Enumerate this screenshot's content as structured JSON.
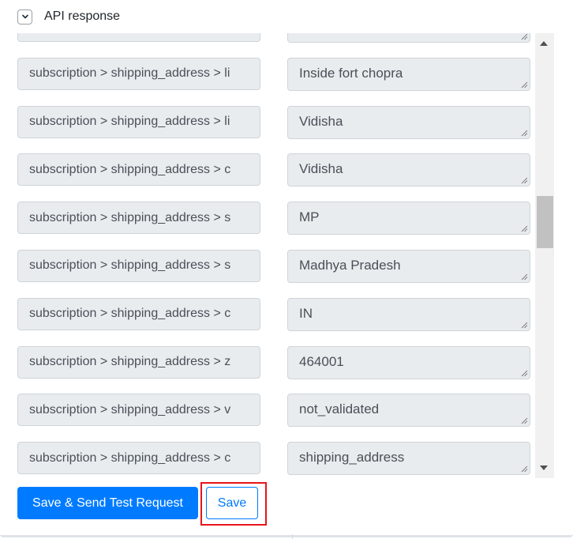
{
  "header": {
    "title": "API response",
    "toggle_icon": "chevron-down-icon"
  },
  "rows": [
    {
      "key": "",
      "value": ""
    },
    {
      "key": "subscription > shipping_address > li",
      "value": "Inside fort chopra"
    },
    {
      "key": "subscription > shipping_address > li",
      "value": "Vidisha"
    },
    {
      "key": "subscription > shipping_address > c",
      "value": "Vidisha"
    },
    {
      "key": "subscription > shipping_address > s",
      "value": "MP"
    },
    {
      "key": "subscription > shipping_address > s",
      "value": "Madhya Pradesh"
    },
    {
      "key": "subscription > shipping_address > c",
      "value": "IN"
    },
    {
      "key": "subscription > shipping_address > z",
      "value": "464001"
    },
    {
      "key": "subscription > shipping_address > v",
      "value": "not_validated"
    },
    {
      "key": "subscription > shipping_address > c",
      "value": "shipping_address"
    }
  ],
  "buttons": {
    "save_send": "Save & Send Test Request",
    "save": "Save"
  },
  "colors": {
    "primary": "#007bff",
    "highlight": "#e8141b",
    "field_bg": "#e9ecef"
  }
}
